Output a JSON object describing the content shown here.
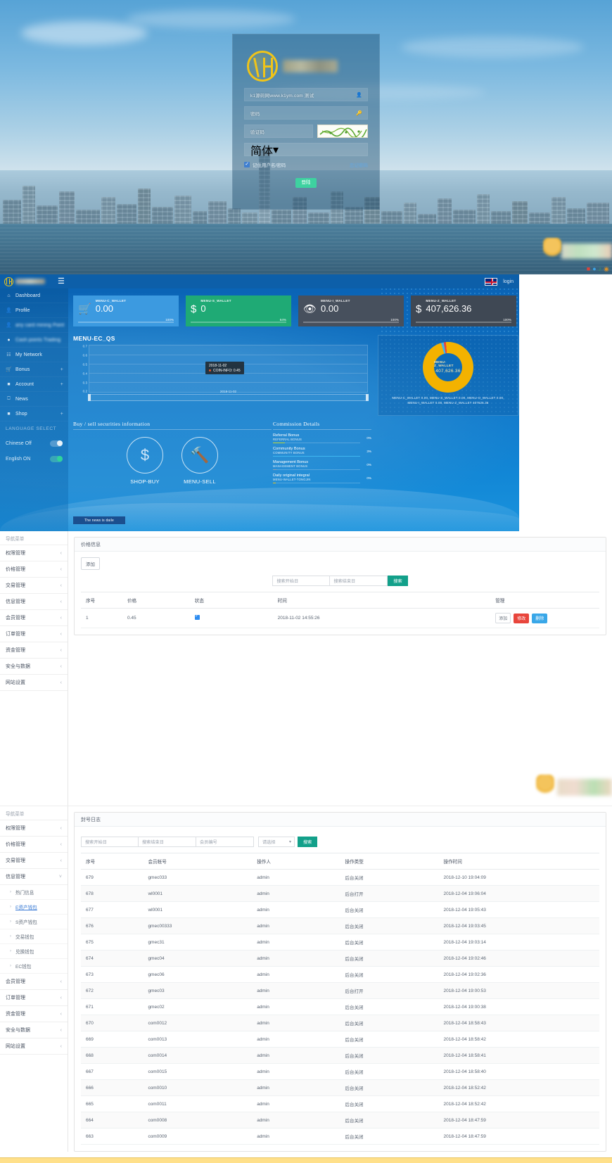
{
  "login": {
    "logo_alt": "AH logo",
    "brand_blurred": true,
    "username_value": "k1源码网www.k1ym.com 测试",
    "password_placeholder": "密码",
    "captcha_placeholder": "验证码",
    "select_value": "简体",
    "remember_label": "记住用户名/密码",
    "forgot_label": "忘记密码",
    "submit_label": "登陆",
    "icons": {
      "user": "user-icon",
      "lock": "key-icon",
      "caret": "chevron-down-icon"
    }
  },
  "dashboard": {
    "topbar": {
      "menu_icon": "hamburger-icon",
      "flag": "uk-flag-icon",
      "lang_label": "login"
    },
    "sidebar": {
      "items": [
        {
          "label": "Dashboard",
          "icon": "home-icon",
          "caret": "",
          "blurred": false
        },
        {
          "label": "Profile",
          "icon": "user-icon",
          "caret": "",
          "blurred": false
        },
        {
          "label": "any card mining Point",
          "icon": "user-icon",
          "caret": "",
          "blurred": true
        },
        {
          "label": "Cash points Trading",
          "icon": "coins-icon",
          "caret": "",
          "blurred": true
        },
        {
          "label": "My Network",
          "icon": "network-icon",
          "caret": "",
          "blurred": false
        },
        {
          "label": "Bonus",
          "icon": "cart-icon",
          "caret": "+",
          "blurred": false
        },
        {
          "label": "Account",
          "icon": "card-icon",
          "caret": "+",
          "blurred": false
        },
        {
          "label": "News",
          "icon": "monitor-icon",
          "caret": "",
          "blurred": false
        },
        {
          "label": "Shop",
          "icon": "card-icon",
          "caret": "+",
          "blurred": false
        }
      ],
      "lang_header": "LANGUAGE SELECT",
      "toggles": [
        {
          "label": "Chinese Off",
          "state": "off"
        },
        {
          "label": "English ON",
          "state": "on"
        }
      ]
    },
    "cards": [
      {
        "label": "MENU-C_WALLET",
        "value": "0.00",
        "percent": "100%",
        "icon": "cart-icon",
        "color": "#3c9ae0"
      },
      {
        "label": "MENU-S_WALLET",
        "value": "0",
        "percent": "64%",
        "icon": "dollar-icon",
        "color": "#1faa75"
      },
      {
        "label": "MENU-I_WALLET",
        "value": "0.00",
        "percent": "100%",
        "icon": "eye-icon",
        "color": "#47505d"
      },
      {
        "label": "MENU-Z_WALLET",
        "value": "407,626.36",
        "percent": "100%",
        "icon": "dollar-icon",
        "color": "#3f4854"
      }
    ],
    "buysell": {
      "title": "Buy / sell securities information",
      "items": [
        {
          "label": "SHOP-BUY",
          "icon": "dollar-icon"
        },
        {
          "label": "MENU-SELL",
          "icon": "hammer-icon"
        }
      ]
    },
    "commission": {
      "title": "Commission Details",
      "rows": [
        {
          "name": "Referral Bonus",
          "sub": "REFERRAL BONUS",
          "pct": "0%",
          "fill": 14,
          "color": "#c3d93a"
        },
        {
          "name": "Community Bonus",
          "sub": "COMMUNITY BONUS",
          "pct": "3%",
          "fill": 100,
          "color": "#3fb7f0"
        },
        {
          "name": "Management Bonus",
          "sub": "MANAGEMENT BONUS",
          "pct": "0%",
          "fill": 4,
          "color": "#8e9fb5"
        },
        {
          "name": "Daily original integral",
          "sub": "MENU-WALLET-TONGJIN",
          "pct": "0%",
          "fill": 3,
          "color": "#f0c419"
        }
      ]
    },
    "news_ticker": "The news is daile"
  },
  "chart_data": [
    {
      "type": "line",
      "title": "MENU-EC_QS",
      "xlabel": "",
      "ylabel": "",
      "ylim": [
        0.2,
        0.7
      ],
      "yticks": [
        "0.7",
        "0.6",
        "0.5",
        "0.4",
        "0.3",
        "0.2"
      ],
      "x": [
        "2018-11-02"
      ],
      "series": [
        {
          "name": "COIN-INFO",
          "values": [
            0.45
          ],
          "color": "#e4572e"
        }
      ],
      "tooltip": {
        "date": "2018-11-02",
        "series": "COIN-INFO",
        "value": "0.45"
      },
      "slider_label": "2018-11-02",
      "grid": true,
      "legend": "none"
    },
    {
      "type": "pie",
      "title": "MENU-Z_WALLET",
      "center_label": "MENU-Z_WALLET",
      "center_value": "407,626.36",
      "labels": [
        "MENU-C_WALLET",
        "MENU-S_WALLET",
        "MENU-O_WALLET",
        "MENU-I_WALLET",
        "MENU-Z_WALLET"
      ],
      "values": [
        0.0,
        0.0,
        0.0,
        0.0,
        407626.36
      ],
      "display": [
        "MENU-C_WALLET  0.00,",
        "MENU-S_WALLET  0.00,",
        "MENU-O_WALLET  0.00,",
        "MENU-I_WALLET  0.00,",
        "MENU-Z_WALLET  407626.36"
      ],
      "legend": "bottom",
      "colors": [
        "#46b3e6",
        "#e8453c",
        "#9ad14b",
        "#b36ae2",
        "#f3b200"
      ]
    }
  ],
  "admin_price": {
    "sidebar": {
      "header": "导航菜单",
      "items": [
        {
          "label": "权限管理",
          "caret": "‹"
        },
        {
          "label": "价格管理",
          "caret": "‹"
        },
        {
          "label": "交易管理",
          "caret": "‹"
        },
        {
          "label": "信息管理",
          "caret": "‹"
        },
        {
          "label": "会员管理",
          "caret": "‹"
        },
        {
          "label": "订单管理",
          "caret": "‹"
        },
        {
          "label": "资金管理",
          "caret": "‹"
        },
        {
          "label": "安全与数据",
          "caret": "‹"
        },
        {
          "label": "网站设置",
          "caret": "‹"
        }
      ]
    },
    "panel_title": "价格信息",
    "add_button": "添加",
    "filters": {
      "start_placeholder": "搜索开始日",
      "end_placeholder": "搜索结束日",
      "search_button": "搜索"
    },
    "table": {
      "columns": [
        "序号",
        "价格",
        "状态",
        "时间",
        "管理"
      ],
      "rows": [
        {
          "no": "1",
          "price": "0.45",
          "status_checked": true,
          "time": "2018-11-02 14:55:26",
          "ops": {
            "add": "添加",
            "edit": "修改",
            "delete": "删除"
          }
        }
      ]
    }
  },
  "admin_log": {
    "sidebar": {
      "header": "导航菜单",
      "items": [
        {
          "label": "权限管理",
          "caret": "‹",
          "type": "group"
        },
        {
          "label": "价格管理",
          "caret": "‹",
          "type": "group"
        },
        {
          "label": "交易管理",
          "caret": "‹",
          "type": "group"
        },
        {
          "label": "信息管理",
          "caret": "˅",
          "type": "group-open"
        },
        {
          "label": "热门信息",
          "caret": "›",
          "type": "sub"
        },
        {
          "label": "E资产钱包",
          "caret": "›",
          "type": "sub-active"
        },
        {
          "label": "S资产钱包",
          "caret": "›",
          "type": "sub"
        },
        {
          "label": "交易钱包",
          "caret": "›",
          "type": "sub"
        },
        {
          "label": "兑换钱包",
          "caret": "›",
          "type": "sub"
        },
        {
          "label": "EC钱包",
          "caret": "›",
          "type": "sub"
        },
        {
          "label": "会员管理",
          "caret": "‹",
          "type": "group"
        },
        {
          "label": "订单管理",
          "caret": "‹",
          "type": "group"
        },
        {
          "label": "资金管理",
          "caret": "‹",
          "type": "group"
        },
        {
          "label": "安全与数据",
          "caret": "‹",
          "type": "group"
        },
        {
          "label": "网站设置",
          "caret": "‹",
          "type": "group"
        }
      ]
    },
    "panel_title": "封号日志",
    "filters": {
      "start_placeholder": "搜索开始日",
      "end_placeholder": "搜索结束日",
      "member_placeholder": "会员编号",
      "select_value": "请选择",
      "search_button": "搜索"
    },
    "table": {
      "columns": [
        "序号",
        "会员帐号",
        "操作人",
        "操作类型",
        "操作时间"
      ],
      "rows": [
        [
          "679",
          "gmec033",
          "admin",
          "后台关闭",
          "2018-12-10 19:04:09"
        ],
        [
          "678",
          "wl0001",
          "admin",
          "后台打开",
          "2018-12-04 19:06:04"
        ],
        [
          "677",
          "wl0001",
          "admin",
          "后台关闭",
          "2018-12-04 19:05:43"
        ],
        [
          "676",
          "gmec00333",
          "admin",
          "后台关闭",
          "2018-12-04 19:03:45"
        ],
        [
          "675",
          "gmec31",
          "admin",
          "后台关闭",
          "2018-12-04 19:03:14"
        ],
        [
          "674",
          "gmec04",
          "admin",
          "后台关闭",
          "2018-12-04 19:02:46"
        ],
        [
          "673",
          "gmec06",
          "admin",
          "后台关闭",
          "2018-12-04 19:02:36"
        ],
        [
          "672",
          "gmec03",
          "admin",
          "后台打开",
          "2018-12-04 19:00:53"
        ],
        [
          "671",
          "gmec02",
          "admin",
          "后台关闭",
          "2018-12-04 19:00:38"
        ],
        [
          "670",
          "com0012",
          "admin",
          "后台关闭",
          "2018-12-04 18:58:43"
        ],
        [
          "669",
          "com0013",
          "admin",
          "后台关闭",
          "2018-12-04 18:58:42"
        ],
        [
          "668",
          "com0014",
          "admin",
          "后台关闭",
          "2018-12-04 18:58:41"
        ],
        [
          "667",
          "com0015",
          "admin",
          "后台关闭",
          "2018-12-04 18:58:40"
        ],
        [
          "666",
          "com0010",
          "admin",
          "后台关闭",
          "2018-12-04 18:52:42"
        ],
        [
          "665",
          "com0011",
          "admin",
          "后台关闭",
          "2018-12-04 18:52:42"
        ],
        [
          "664",
          "com0008",
          "admin",
          "后台关闭",
          "2018-12-04 18:47:59"
        ],
        [
          "663",
          "com0009",
          "admin",
          "后台关闭",
          "2018-12-04 18:47:59"
        ]
      ]
    }
  }
}
